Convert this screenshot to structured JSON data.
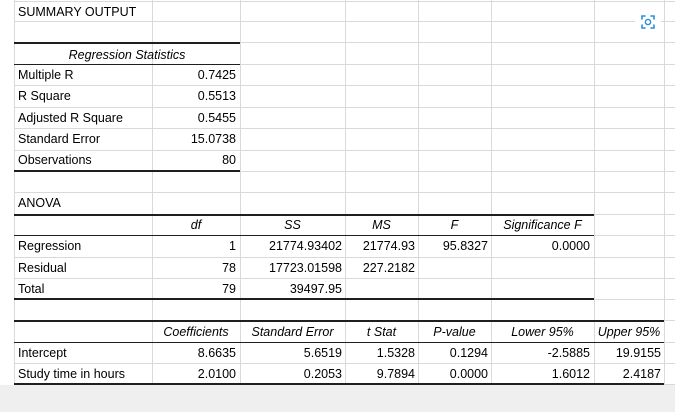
{
  "title": "SUMMARY OUTPUT",
  "regression_statistics": {
    "header": "Regression Statistics",
    "rows": [
      {
        "label": "Multiple R",
        "value": "0.7425"
      },
      {
        "label": "R Square",
        "value": "0.5513"
      },
      {
        "label": "Adjusted R Square",
        "value": "0.5455"
      },
      {
        "label": "Standard Error",
        "value": "15.0738"
      },
      {
        "label": "Observations",
        "value": "80"
      }
    ]
  },
  "anova": {
    "title": "ANOVA",
    "headers": {
      "df": "df",
      "ss": "SS",
      "ms": "MS",
      "f": "F",
      "sig": "Significance F"
    },
    "rows": [
      {
        "label": "Regression",
        "df": "1",
        "ss": "21774.93402",
        "ms": "21774.93",
        "f": "95.8327",
        "sig": "0.0000"
      },
      {
        "label": "Residual",
        "df": "78",
        "ss": "17723.01598",
        "ms": "227.2182",
        "f": "",
        "sig": ""
      },
      {
        "label": "Total",
        "df": "79",
        "ss": "39497.95",
        "ms": "",
        "f": "",
        "sig": ""
      }
    ]
  },
  "coefficients": {
    "headers": {
      "coef": "Coefficients",
      "se": "Standard Error",
      "t": "t Stat",
      "p": "P-value",
      "lower": "Lower 95%",
      "upper": "Upper 95%"
    },
    "rows": [
      {
        "label": "Intercept",
        "coef": "8.6635",
        "se": "5.6519",
        "t": "1.5328",
        "p": "0.1294",
        "lower": "-2.5885",
        "upper": "19.9155"
      },
      {
        "label": "Study time in hours",
        "coef": "2.0100",
        "se": "0.2053",
        "t": "9.7894",
        "p": "0.0000",
        "lower": "1.6012",
        "upper": "2.4187"
      }
    ]
  },
  "icons": {
    "expand": "expand-icon"
  },
  "colors": {
    "gridline": "#d9d9d9",
    "border": "#1f1f1f",
    "accent": "#2b8fd6"
  }
}
